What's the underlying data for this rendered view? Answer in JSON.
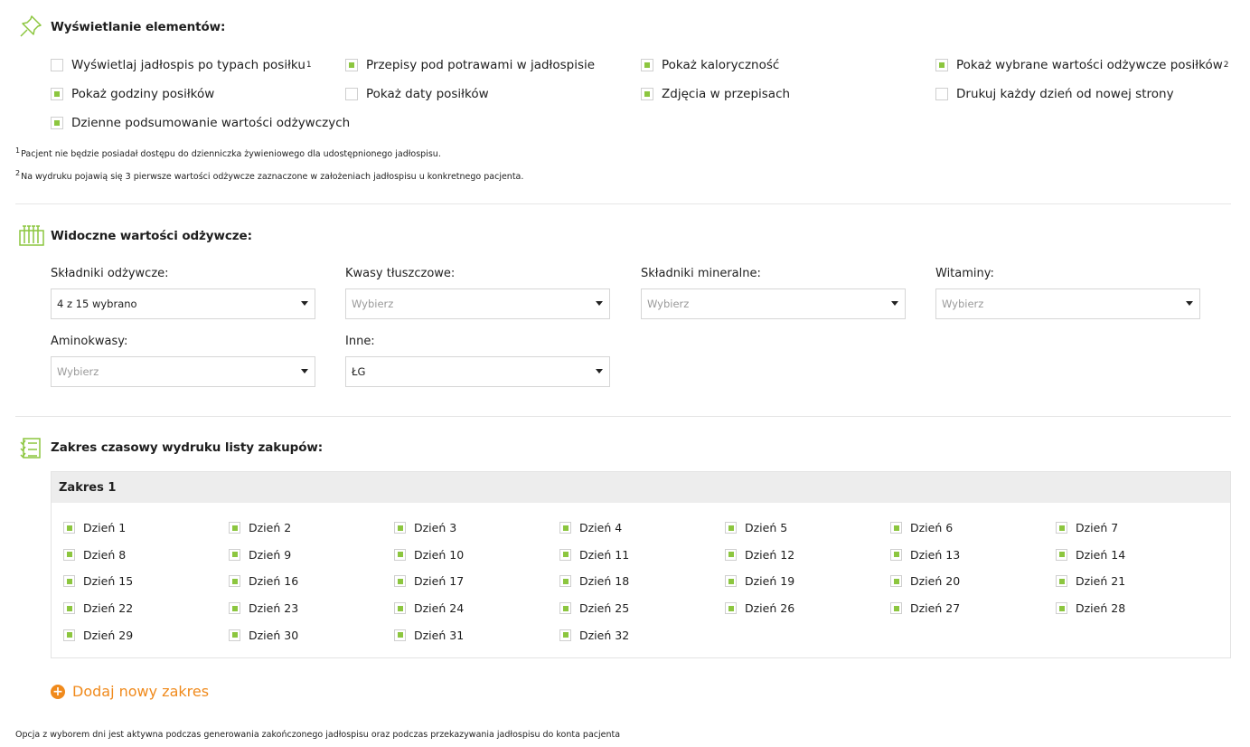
{
  "display": {
    "title": "Wyświetlanie elementów:",
    "options": [
      {
        "label": "Wyświetlaj jadłospis po typach posiłku",
        "sup": "1",
        "checked": false
      },
      {
        "label": "Przepisy pod potrawami w jadłospisie",
        "sup": "",
        "checked": true
      },
      {
        "label": "Pokaż kaloryczność",
        "sup": "",
        "checked": true
      },
      {
        "label": "Pokaż wybrane wartości odżywcze posiłków",
        "sup": "2",
        "checked": true
      },
      {
        "label": "Pokaż godziny posiłków",
        "sup": "",
        "checked": true
      },
      {
        "label": "Pokaż daty posiłków",
        "sup": "",
        "checked": false
      },
      {
        "label": "Zdjęcia w przepisach",
        "sup": "",
        "checked": true
      },
      {
        "label": "Drukuj każdy dzień od nowej strony",
        "sup": "",
        "checked": false
      },
      {
        "label": "Dzienne podsumowanie wartości odżywczych",
        "sup": "",
        "checked": true
      }
    ],
    "notes": [
      {
        "sup": "1",
        "text": "Pacjent nie będzie posiadał dostępu do dzienniczka żywieniowego dla udostępnionego jadłospisu."
      },
      {
        "sup": "2",
        "text": "Na wydruku pojawią się 3 pierwsze wartości odżywcze zaznaczone w założeniach jadłospisu u konkretnego pacjenta."
      }
    ]
  },
  "nutrients": {
    "title": "Widoczne wartości odżywcze:",
    "fields": [
      {
        "label": "Składniki odżywcze:",
        "value": "4 z 15 wybrano",
        "placeholder": false
      },
      {
        "label": "Kwasy tłuszczowe:",
        "value": "Wybierz",
        "placeholder": true
      },
      {
        "label": "Składniki mineralne:",
        "value": "Wybierz",
        "placeholder": true
      },
      {
        "label": "Witaminy:",
        "value": "Wybierz",
        "placeholder": true
      },
      {
        "label": "Aminokwasy:",
        "value": "Wybierz",
        "placeholder": true
      },
      {
        "label": "Inne:",
        "value": "ŁG",
        "placeholder": false
      }
    ]
  },
  "shopping": {
    "title": "Zakres czasowy wydruku listy zakupów:",
    "range_title": "Zakres 1",
    "days": [
      "Dzień 1",
      "Dzień 2",
      "Dzień 3",
      "Dzień 4",
      "Dzień 5",
      "Dzień 6",
      "Dzień 7",
      "Dzień 8",
      "Dzień 9",
      "Dzień 10",
      "Dzień 11",
      "Dzień 12",
      "Dzień 13",
      "Dzień 14",
      "Dzień 15",
      "Dzień 16",
      "Dzień 17",
      "Dzień 18",
      "Dzień 19",
      "Dzień 20",
      "Dzień 21",
      "Dzień 22",
      "Dzień 23",
      "Dzień 24",
      "Dzień 25",
      "Dzień 26",
      "Dzień 27",
      "Dzień 28",
      "Dzień 29",
      "Dzień 30",
      "Dzień 31",
      "Dzień 32"
    ],
    "add_label": "Dodaj nowy zakres",
    "footer": "Opcja z wyborem dni jest aktywna podczas generowania zakończonego jadłospisu oraz podczas przekazywania jadłospisu do konta pacjenta"
  },
  "colors": {
    "accent_green": "#8cc63f",
    "accent_orange": "#f08a1c"
  }
}
